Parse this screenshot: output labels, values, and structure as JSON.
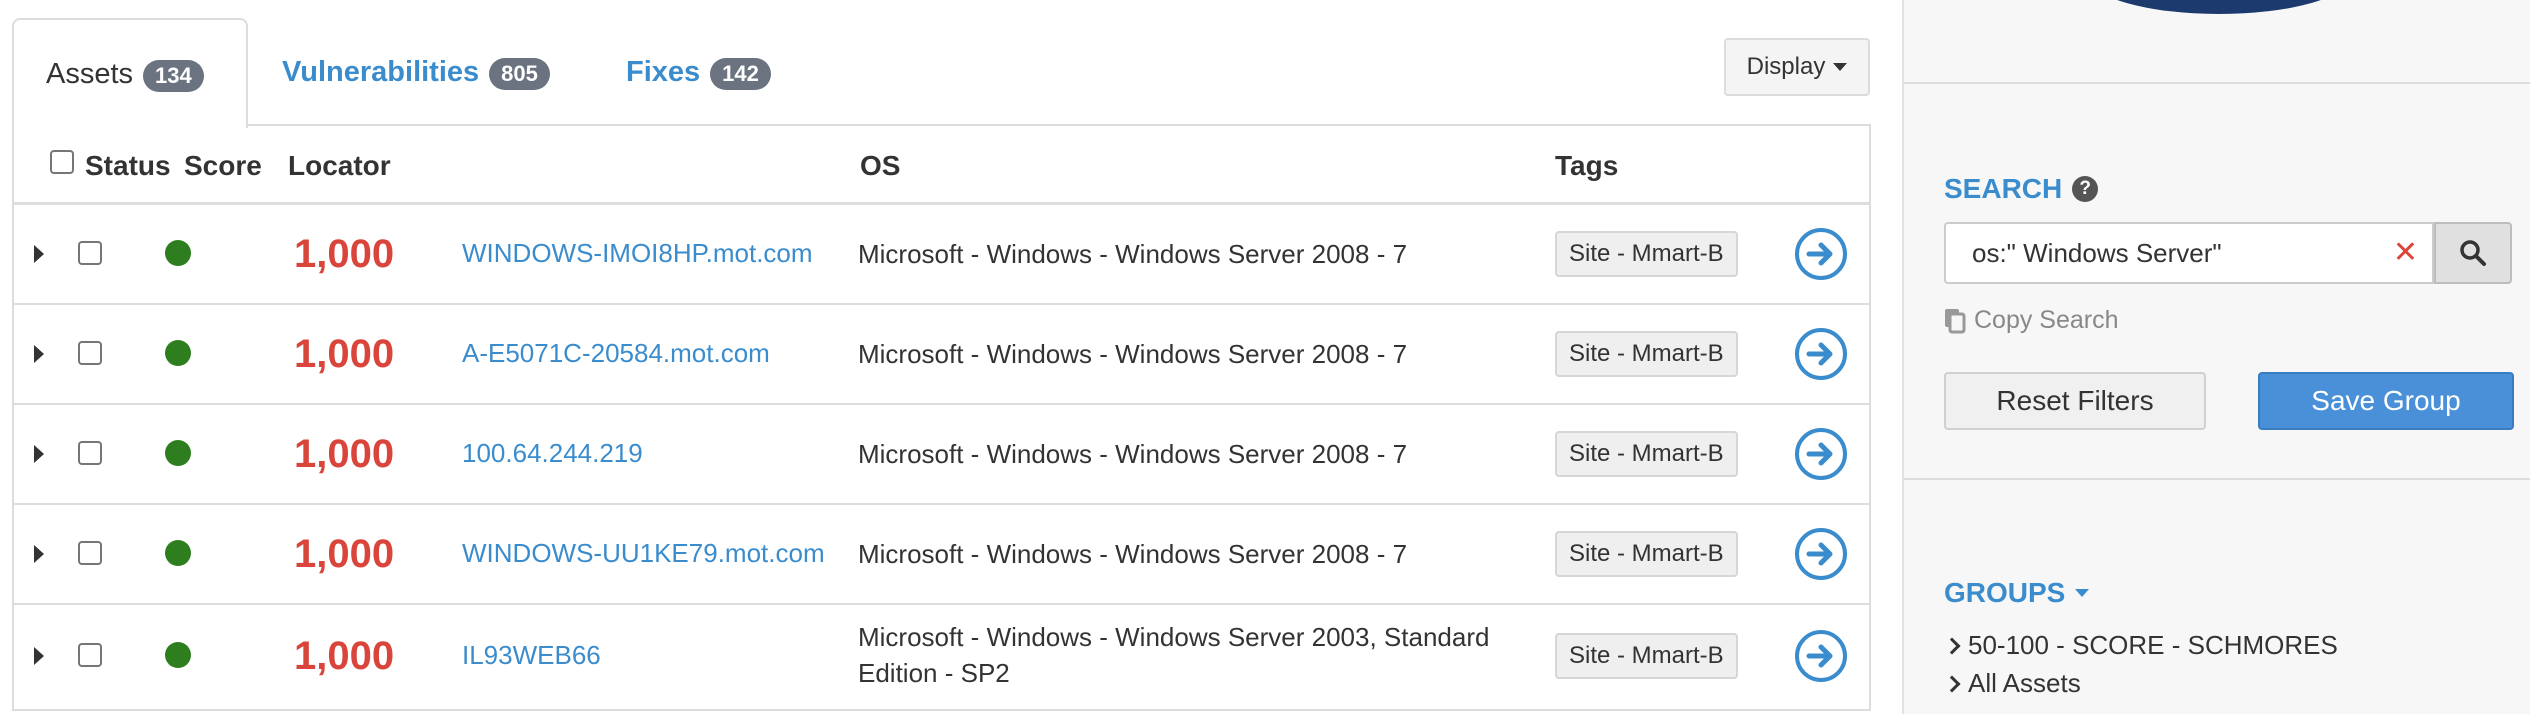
{
  "tabs": [
    {
      "label": "Assets",
      "count": "134"
    },
    {
      "label": "Vulnerabilities",
      "count": "805"
    },
    {
      "label": "Fixes",
      "count": "142"
    }
  ],
  "display_button": "Display",
  "table": {
    "headers": {
      "status": "Status",
      "score": "Score",
      "locator": "Locator",
      "os": "OS",
      "tags": "Tags"
    },
    "rows": [
      {
        "score": "1,000",
        "locator": "WINDOWS-IMOI8HP.mot.com",
        "os": "Microsoft - Windows - Windows Server 2008 - 7",
        "tag": "Site - Mmart-B",
        "status": "green"
      },
      {
        "score": "1,000",
        "locator": "A-E5071C-20584.mot.com",
        "os": "Microsoft - Windows - Windows Server 2008 - 7",
        "tag": "Site - Mmart-B",
        "status": "green"
      },
      {
        "score": "1,000",
        "locator": "100.64.244.219",
        "os": "Microsoft - Windows - Windows Server 2008 - 7",
        "tag": "Site - Mmart-B",
        "status": "green"
      },
      {
        "score": "1,000",
        "locator": "WINDOWS-UU1KE79.mot.com",
        "os": "Microsoft - Windows - Windows Server 2008 - 7",
        "tag": "Site - Mmart-B",
        "status": "green"
      },
      {
        "score": "1,000",
        "locator": "IL93WEB66",
        "os": "Microsoft - Windows - Windows Server 2003, Standard Edition - SP2",
        "tag": "Site - Mmart-B",
        "status": "green"
      }
    ]
  },
  "sidebar": {
    "search": {
      "title": "SEARCH",
      "help_icon": "?",
      "value": "os:\" Windows Server\"",
      "clear_icon": "✕",
      "copy_label": "Copy Search"
    },
    "reset_label": "Reset Filters",
    "save_label": "Save Group",
    "groups": {
      "title": "GROUPS",
      "items": [
        "50-100 - SCORE - SCHMORES",
        "All Assets"
      ]
    }
  },
  "colors": {
    "accent": "#3a8ccd",
    "score": "#d9453b",
    "status_ok": "#2e7d1e",
    "save_button": "#4a90d9"
  }
}
